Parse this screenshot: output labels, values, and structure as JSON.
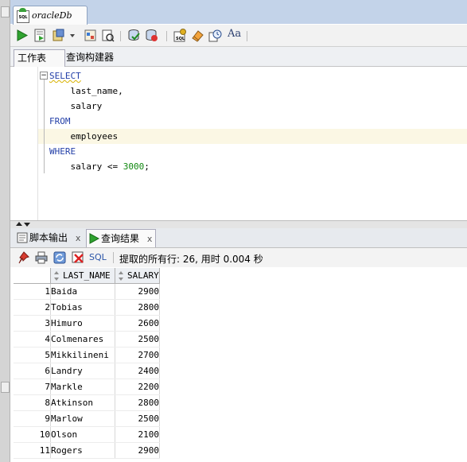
{
  "window": {
    "doc_tab_label": "oracleDb",
    "doc_tab_icon_text": "SQL"
  },
  "toolbar": {
    "icons": [
      "run-statement-icon",
      "run-script-icon",
      "commit-icon",
      "dropdown-icon",
      "explain-plan-icon",
      "autotrace-icon",
      "commit-db-icon",
      "rollback-icon",
      "sql-tuning-icon",
      "eraser-icon",
      "history-icon",
      "format-case-icon"
    ],
    "case_label": "Aa"
  },
  "editor_tabs": [
    "工作表",
    "查询构建器"
  ],
  "editor": {
    "lines": [
      {
        "text": "SELECT",
        "type": "keyword"
      },
      {
        "text": "    last_name,",
        "type": "code"
      },
      {
        "text": "    salary",
        "type": "code"
      },
      {
        "text": "FROM",
        "type": "keyword"
      },
      {
        "text": "    employees",
        "type": "code"
      },
      {
        "text": "WHERE",
        "type": "keyword"
      }
    ],
    "where_clause": {
      "prefix": "    salary <= ",
      "number": "3000",
      "suffix": ";"
    },
    "fold_glyph": "−"
  },
  "output_tabs": [
    {
      "label": "脚本输出",
      "close": "x"
    },
    {
      "label": "查询结果",
      "close": "x"
    }
  ],
  "results_toolbar": {
    "sql_label": "SQL",
    "status": "提取的所有行: 26, 用时 0.004 秒"
  },
  "grid": {
    "columns": [
      "LAST_NAME",
      "SALARY"
    ],
    "rows": [
      [
        "1",
        "Baida",
        "2900"
      ],
      [
        "2",
        "Tobias",
        "2800"
      ],
      [
        "3",
        "Himuro",
        "2600"
      ],
      [
        "4",
        "Colmenares",
        "2500"
      ],
      [
        "5",
        "Mikkilineni",
        "2700"
      ],
      [
        "6",
        "Landry",
        "2400"
      ],
      [
        "7",
        "Markle",
        "2200"
      ],
      [
        "8",
        "Atkinson",
        "2800"
      ],
      [
        "9",
        "Marlow",
        "2500"
      ],
      [
        "10",
        "Olson",
        "2100"
      ],
      [
        "11",
        "Rogers",
        "2900"
      ]
    ]
  }
}
